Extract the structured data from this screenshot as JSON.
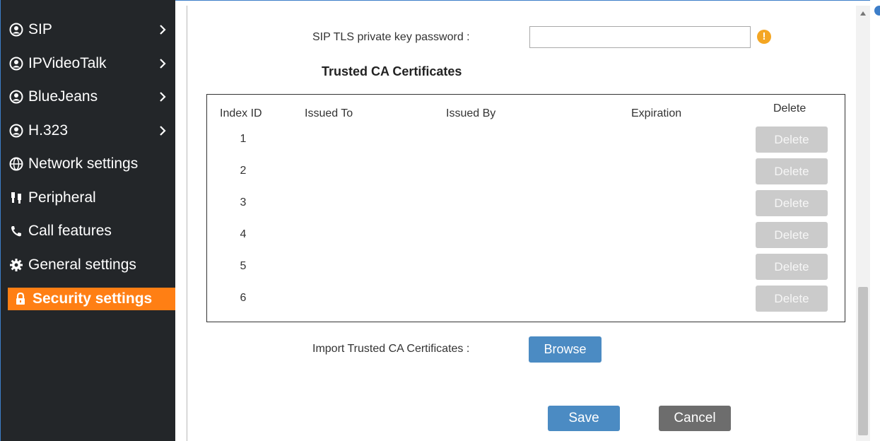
{
  "sidebar": {
    "items": [
      {
        "label": "SIP",
        "icon": "user-circle-icon",
        "has_submenu": true
      },
      {
        "label": "IPVideoTalk",
        "icon": "user-circle-icon",
        "has_submenu": true
      },
      {
        "label": "BlueJeans",
        "icon": "user-circle-icon",
        "has_submenu": true
      },
      {
        "label": "H.323",
        "icon": "user-circle-icon",
        "has_submenu": true
      },
      {
        "label": "Network settings",
        "icon": "globe-icon",
        "has_submenu": false
      },
      {
        "label": "Peripheral",
        "icon": "plug-icon",
        "has_submenu": false
      },
      {
        "label": "Call features",
        "icon": "phone-icon",
        "has_submenu": false
      },
      {
        "label": "General settings",
        "icon": "gear-icon",
        "has_submenu": false
      },
      {
        "label": "Security settings",
        "icon": "lock-icon",
        "has_submenu": false,
        "active": true
      }
    ]
  },
  "form": {
    "tls_password_label": "SIP TLS private key password :",
    "tls_password_value": "",
    "warning_symbol": "!",
    "section_title": "Trusted CA Certificates",
    "import_label": "Import Trusted CA Certificates :",
    "browse_label": "Browse"
  },
  "table": {
    "headers": [
      "Index ID",
      "Issued To",
      "Issued By",
      "Expiration",
      "Delete"
    ],
    "rows": [
      {
        "id": "1",
        "delete_label": "Delete"
      },
      {
        "id": "2",
        "delete_label": "Delete"
      },
      {
        "id": "3",
        "delete_label": "Delete"
      },
      {
        "id": "4",
        "delete_label": "Delete"
      },
      {
        "id": "5",
        "delete_label": "Delete"
      },
      {
        "id": "6",
        "delete_label": "Delete"
      }
    ]
  },
  "actions": {
    "save_label": "Save",
    "cancel_label": "Cancel"
  },
  "colors": {
    "sidebar_bg": "#232629",
    "active_item": "#ff7f14",
    "primary_button": "#4b8bc3",
    "cancel_button": "#6d6d6d",
    "disabled_button": "#cbcbcb",
    "warning": "#f4a623"
  }
}
